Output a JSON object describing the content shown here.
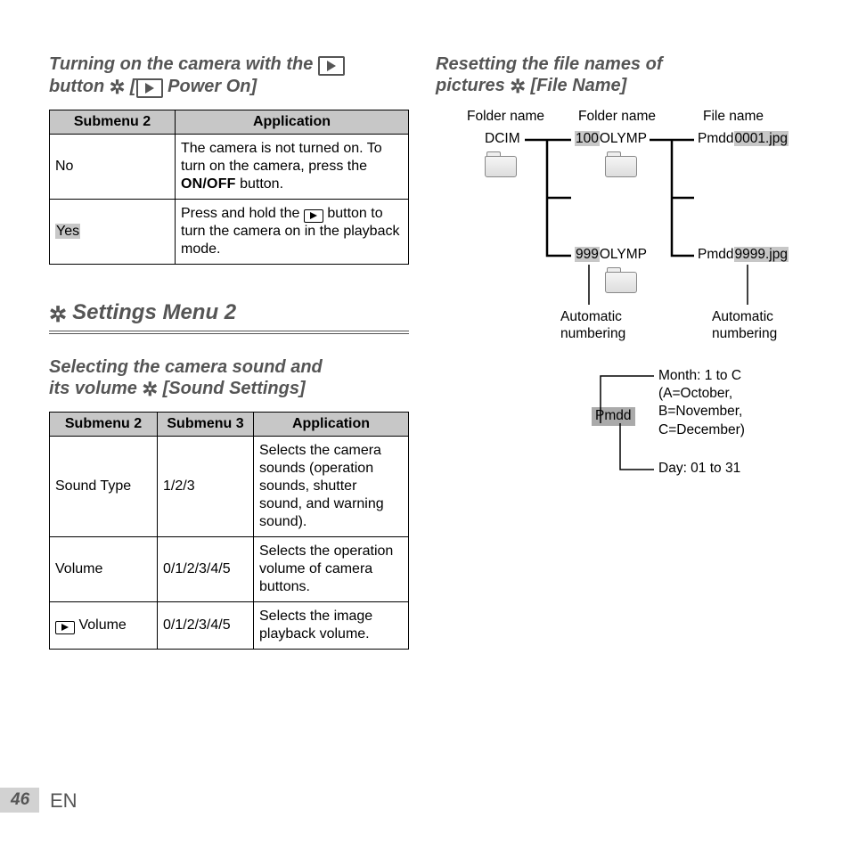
{
  "section1": {
    "title_pre": "Turning on the camera with the ",
    "title_mid": " button ",
    "title_suf": " Power On]",
    "table": {
      "head": [
        "Submenu 2",
        "Application"
      ],
      "rows": [
        [
          "No",
          "The camera is not turned on. To turn on the camera, press the ",
          "ON/OFF",
          " button."
        ],
        [
          "Yes",
          "Press and hold the ",
          " button to turn the camera on in the playback mode."
        ]
      ]
    }
  },
  "banner": {
    "title": "Settings Menu 2"
  },
  "section2": {
    "title_line1": "Selecting the camera sound and",
    "title_line2_pre": "its volume ",
    "title_line2_suf": " [Sound Settings]",
    "table": {
      "head": [
        "Submenu 2",
        "Submenu 3",
        "Application"
      ],
      "rows": [
        {
          "c1": "Sound Type",
          "c2": "1/2/3",
          "c3": "Selects the camera sounds (operation sounds, shutter sound, and warning sound)."
        },
        {
          "c1": "Volume",
          "c2": "0/1/2/3/4/5",
          "c3": "Selects the operation volume of camera buttons."
        },
        {
          "c1_icon": true,
          "c1": " Volume",
          "c2": "0/1/2/3/4/5",
          "c3": "Selects the image playback volume."
        }
      ]
    }
  },
  "section3": {
    "title_line1": "Resetting the file names of",
    "title_line2_pre": "pictures ",
    "title_line2_suf": " [File Name]"
  },
  "diagram": {
    "labels": {
      "folder_name1": "Folder name",
      "folder_name2": "Folder name",
      "file_name": "File name",
      "dcim": "DCIM",
      "f100": "100",
      "olymp1": "OLYMP",
      "f999": "999",
      "olymp2": "OLYMP",
      "pmdd1": "Pmdd",
      "file0001": "0001.jpg",
      "pmdd2": "Pmdd",
      "file9999": "9999.jpg",
      "auto1": "Automatic numbering",
      "auto2": "Automatic numbering",
      "pmdd_box": "Pmdd",
      "month": "Month: 1 to C\n(A=October,\nB=November,\nC=December)",
      "day": "Day: 01 to 31"
    }
  },
  "footer": {
    "page": "46",
    "lang": "EN"
  }
}
